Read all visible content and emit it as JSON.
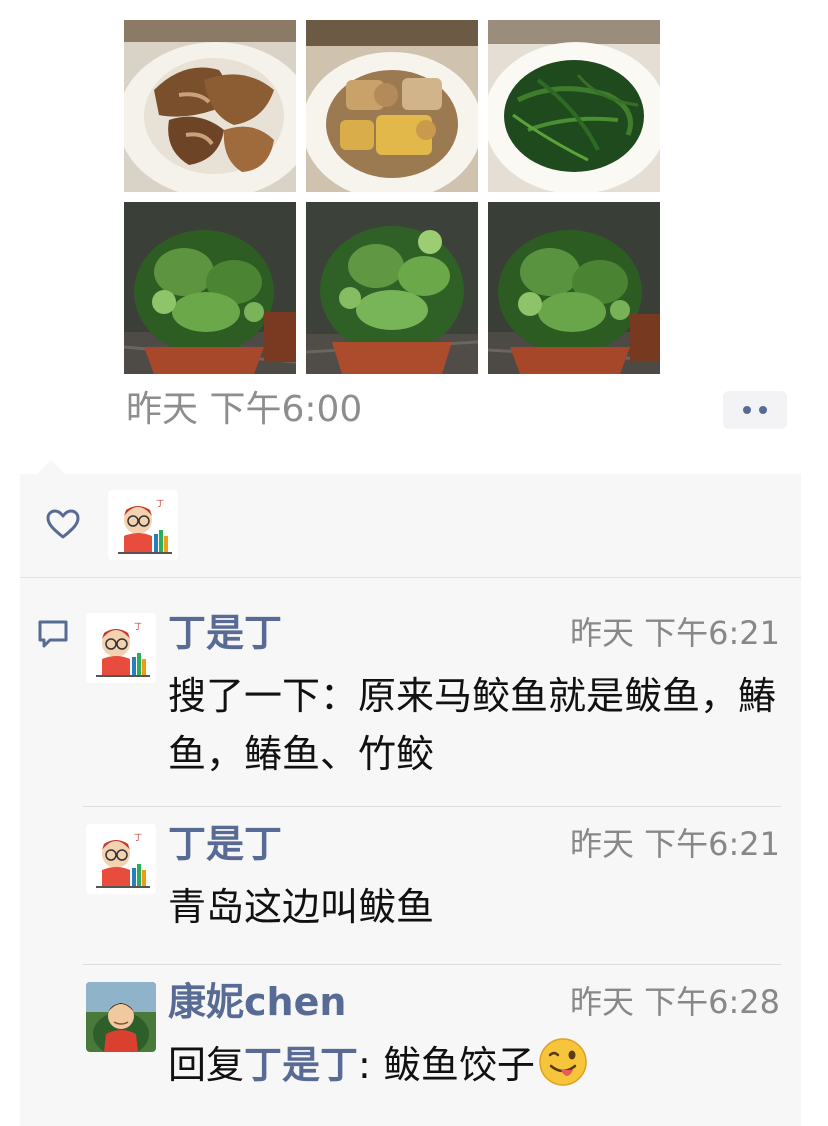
{
  "post": {
    "time": "昨天 下午6:00",
    "photos": [
      {
        "icon": "fried-fish-photo"
      },
      {
        "icon": "braised-dish-photo"
      },
      {
        "icon": "stir-fried-greens-photo"
      },
      {
        "icon": "potted-plant-photo"
      },
      {
        "icon": "potted-plant-photo"
      },
      {
        "icon": "potted-plant-photo"
      }
    ],
    "more_icon": "more-dots-icon"
  },
  "likes": {
    "icon": "heart-icon",
    "avatars": [
      {
        "icon": "cartoon-avatar"
      }
    ]
  },
  "comments": [
    {
      "author": "丁是丁",
      "time": "昨天 下午6:21",
      "text": "搜了一下：原来马鲛鱼就是鲅鱼，鰆鱼，䲠鱼、竹鲛",
      "avatar": "cartoon-avatar"
    },
    {
      "author": "丁是丁",
      "time": "昨天 下午6:21",
      "text": "青岛这边叫鲅鱼",
      "avatar": "cartoon-avatar"
    },
    {
      "author": "康妮chen",
      "time": "昨天 下午6:28",
      "reply_prefix": "回复",
      "reply_to": "丁是丁",
      "text": ": 鲅鱼饺子",
      "emoji": "wink-tongue-emoji",
      "avatar": "child-photo-avatar"
    }
  ],
  "colors": {
    "link_blue": "#576b95",
    "panel_bg": "#f7f7f7",
    "meta_gray": "#8d8d8d"
  }
}
